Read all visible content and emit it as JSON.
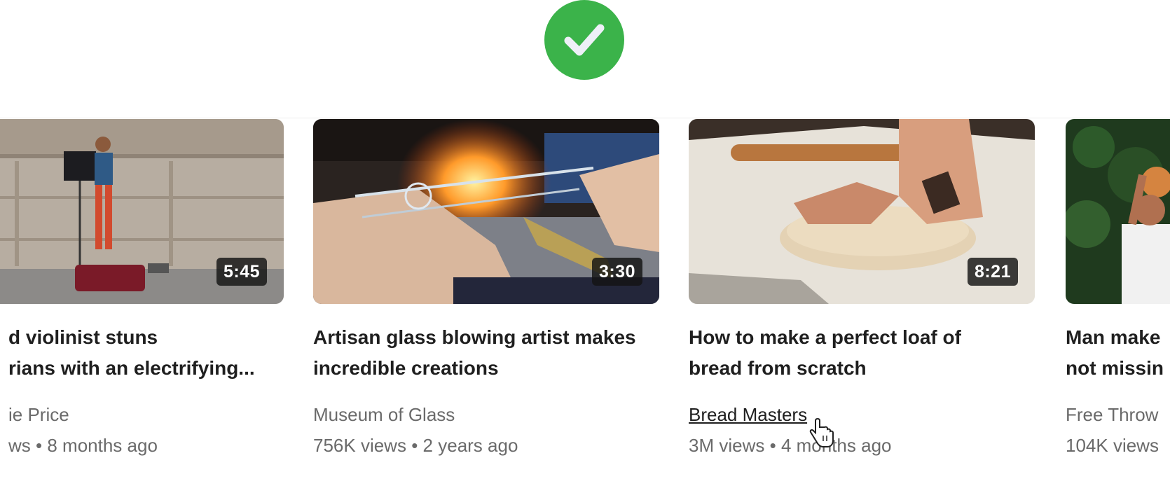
{
  "status": {
    "icon": "checkmark-icon",
    "color": "#3bb34a"
  },
  "videos": [
    {
      "title_line1": "d violinist stuns",
      "title_line2": "rians with an electrifying...",
      "channel": "ie Price",
      "views": "ws",
      "age": "8 months ago",
      "duration": "5:45",
      "thumbnail_icon": "violinist-thumbnail"
    },
    {
      "title_line1": "Artisan glass blowing artist makes",
      "title_line2": "incredible creations",
      "channel": "Museum of Glass",
      "views": "756K views",
      "age": "2 years ago",
      "duration": "3:30",
      "thumbnail_icon": "glassblowing-thumbnail"
    },
    {
      "title_line1": "How to make a perfect loaf of",
      "title_line2": "bread from scratch",
      "channel": "Bread Masters",
      "views": "3M views",
      "age": "4 months ago",
      "duration": "8:21",
      "thumbnail_icon": "bread-dough-thumbnail"
    },
    {
      "title_line1": "Man make",
      "title_line2": "not missin",
      "channel": "Free Throw",
      "views": "104K views",
      "age": "",
      "duration": "",
      "thumbnail_icon": "basketball-thumbnail"
    }
  ],
  "meta_separator": "•"
}
